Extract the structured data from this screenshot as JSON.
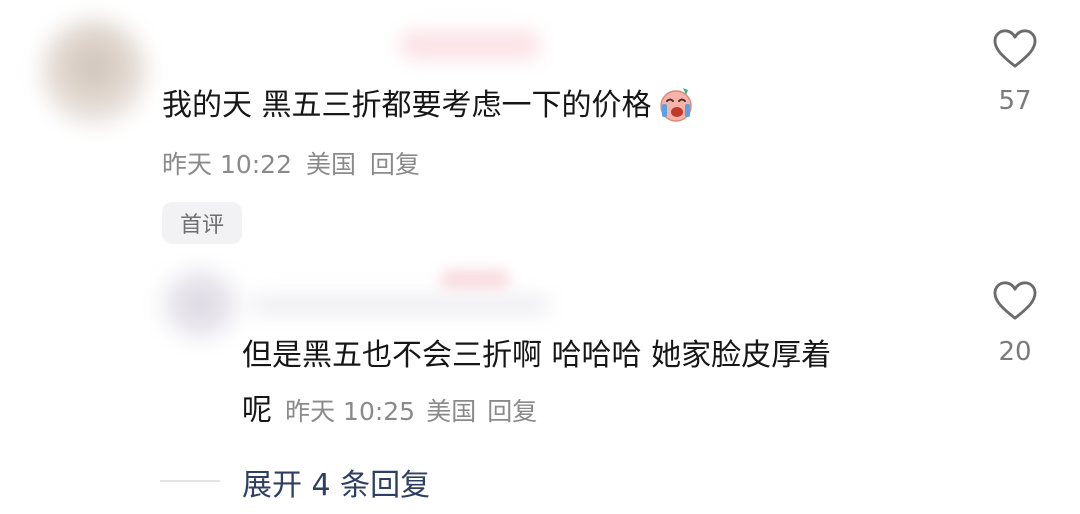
{
  "comment1": {
    "text": "我的天 黑五三折都要考虑一下的价格",
    "emoji": "crying-face-icon",
    "time": "昨天 10:22",
    "location": "美国",
    "reply": "回复",
    "badge": "首评",
    "likes": "57"
  },
  "comment2": {
    "text_line1": "但是黑五也不会三折啊 哈哈哈 她家脸皮厚着",
    "text_line2": "呢",
    "time": "昨天 10:25",
    "location": "美国",
    "reply": "回复",
    "likes": "20"
  },
  "expand": {
    "label": "展开 4 条回复"
  },
  "colors": {
    "text": "#161616",
    "meta": "#8a8a8a",
    "link": "#2f3f62"
  }
}
